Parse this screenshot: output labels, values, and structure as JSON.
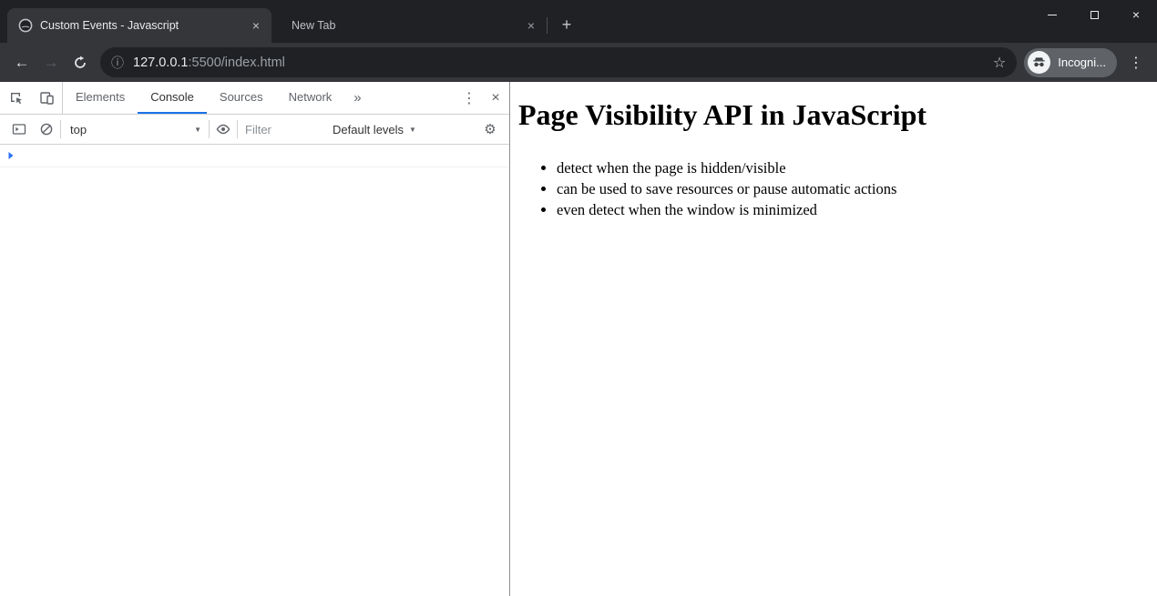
{
  "titlebar": {
    "tabs": [
      {
        "title": "Custom Events - Javascript",
        "active": true
      },
      {
        "title": "New Tab",
        "active": false
      }
    ],
    "new_tab_glyph": "+",
    "close_glyph": "×"
  },
  "toolbar": {
    "url": {
      "host": "127.0.0.1",
      "suffix": ":5500/index.html"
    },
    "incognito_label": "Incogni..."
  },
  "devtools": {
    "tabs": [
      {
        "label": "Elements",
        "active": false
      },
      {
        "label": "Console",
        "active": true
      },
      {
        "label": "Sources",
        "active": false
      },
      {
        "label": "Network",
        "active": false
      }
    ],
    "more_tabs_glyph": "»",
    "console_toolbar": {
      "context": "top",
      "filter_placeholder": "Filter",
      "levels": "Default levels"
    }
  },
  "page": {
    "heading": "Page Visibility API in JavaScript",
    "bullets": [
      "detect when the page is hidden/visible",
      "can be used to save resources or pause automatic actions",
      "even detect when the window is minimized"
    ]
  },
  "icons": {
    "back": "←",
    "forward": "→",
    "info": "ⓘ",
    "star": "☆",
    "browser_menu": "⋮",
    "devtools_menu": "⋮",
    "close": "×",
    "dropdown": "▼",
    "gear": "⚙"
  },
  "colors": {
    "titlebar_bg": "#202124",
    "toolbar_bg": "#35363a",
    "omnibox_bg": "#202124",
    "accent_blue": "#1a73e8",
    "devtools_text": "#5f6368",
    "incognito_chip_bg": "#5f6368"
  }
}
